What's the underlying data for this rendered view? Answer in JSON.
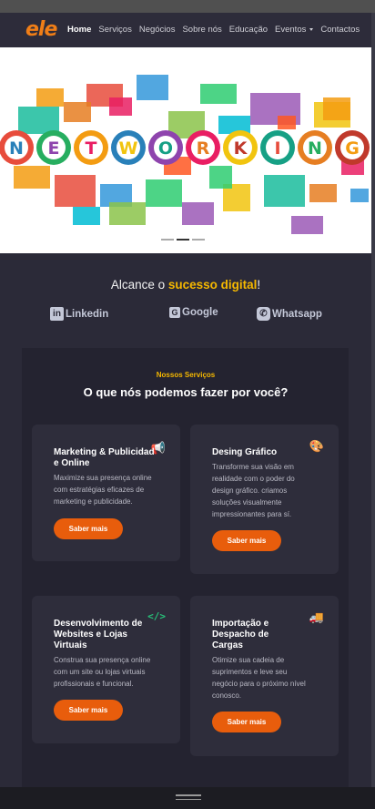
{
  "brand": {
    "logo_text": "ele"
  },
  "nav": {
    "items": [
      "Home",
      "Serviços",
      "Negócios",
      "Sobre nós",
      "Educação",
      "Eventos",
      "Contactos"
    ]
  },
  "banner": {
    "letters": [
      "N",
      "E",
      "T",
      "W",
      "O",
      "R",
      "K",
      "I",
      "N",
      "G"
    ],
    "letter_colors": [
      "#e74c3c",
      "#27ae60",
      "#f39c12",
      "#2980b9",
      "#8e44ad",
      "#e91e63",
      "#f1c40f",
      "#16a085",
      "#e67e22",
      "#c0392b"
    ]
  },
  "tagline": {
    "prefix": "Alcance o ",
    "highlight": "sucesso digital",
    "suffix": "!"
  },
  "social": {
    "linkedin": {
      "icon": "linkedin-icon",
      "label": "Linkedin"
    },
    "google": {
      "icon": "google-icon",
      "label": "Google"
    },
    "whatsapp": {
      "icon": "whatsapp-icon",
      "label": "Whatsapp"
    }
  },
  "services": {
    "subtitle": "Nossos Serviços",
    "title": "O que nós podemos fazer por você?",
    "cards": [
      {
        "title_lines": [
          "Marketing & Publicidad",
          "e Online"
        ],
        "desc_lines": [
          "Maximize sua presença online",
          "com estratégias eficazes de",
          "marketing e publicidade."
        ],
        "button": "Saber mais",
        "icon": "megaphone-icon"
      },
      {
        "title_lines": [
          "Desing Gráfico"
        ],
        "desc_lines": [
          "Transforme sua visão em",
          "realidade com o poder do",
          "design gráfico. criamos",
          "soluções visualmente",
          "impressionantes para sí."
        ],
        "button": "Saber mais",
        "icon": "palette-icon"
      },
      {
        "title_lines": [
          "Desenvolvimento de",
          "Websites  e Lojas",
          "Virtuais"
        ],
        "desc_lines": [
          "Construa sua presença online",
          "com um site ou lojas virtuais",
          "profissionais e funcional."
        ],
        "button": "Saber mais",
        "icon": "code-icon"
      },
      {
        "title_lines": [
          "Importação e",
          "Despacho de",
          "Cargas"
        ],
        "desc_lines": [
          "Otimize sua cadeia de",
          "suprimentos e leve seu",
          "negócio para o próximo nível",
          "conosco."
        ],
        "button": "Saber mais",
        "icon": "truck-icon"
      }
    ]
  },
  "colors": {
    "accent": "#e85d0c",
    "highlight": "#f5b800",
    "icon_green": "#27c27a",
    "background": "#2b2a38"
  }
}
